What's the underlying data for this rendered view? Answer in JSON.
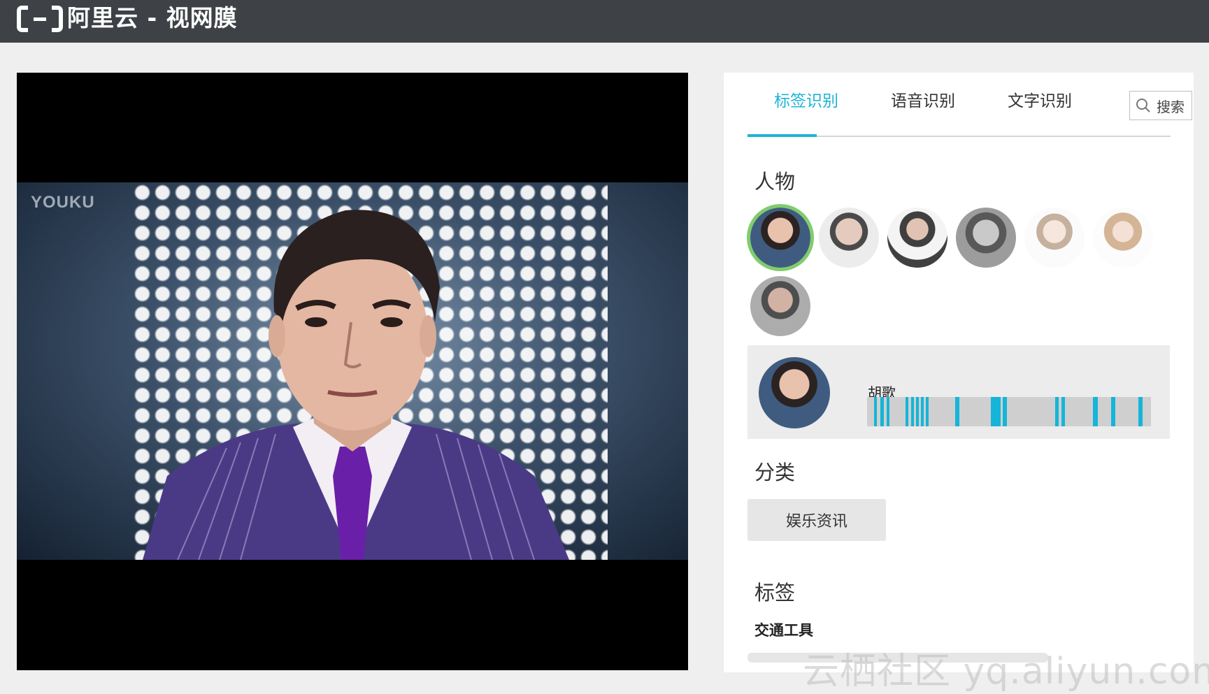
{
  "header": {
    "brand": "阿里云 - 视网膜",
    "logo_icon": "aliyun-logo-icon",
    "background": "#3e4247"
  },
  "video": {
    "watermark": "YOUKU"
  },
  "panel": {
    "tabs": [
      {
        "label": "标签识别",
        "active": true
      },
      {
        "label": "语音识别",
        "active": false
      },
      {
        "label": "文字识别",
        "active": false
      }
    ],
    "search": {
      "placeholder": "搜索",
      "icon": "search-icon"
    },
    "people": {
      "title": "人物",
      "avatar_count": 7,
      "selected_index": 0,
      "selected": {
        "name": "胡歌",
        "timeline_segments": [
          [
            0.025,
            0.035
          ],
          [
            0.047,
            0.058
          ],
          [
            0.07,
            0.08
          ],
          [
            0.135,
            0.145
          ],
          [
            0.155,
            0.165
          ],
          [
            0.172,
            0.182
          ],
          [
            0.19,
            0.2
          ],
          [
            0.207,
            0.216
          ],
          [
            0.31,
            0.325
          ],
          [
            0.435,
            0.47
          ],
          [
            0.478,
            0.492
          ],
          [
            0.662,
            0.675
          ],
          [
            0.685,
            0.698
          ],
          [
            0.795,
            0.812
          ],
          [
            0.86,
            0.875
          ],
          [
            0.955,
            0.97
          ]
        ]
      }
    },
    "category": {
      "title": "分类",
      "tags": [
        "娱乐资讯"
      ]
    },
    "labels": {
      "title": "标签",
      "subheading": "交通工具"
    }
  },
  "site_watermark": "云栖社区 yq.aliyun.com",
  "colors": {
    "accent": "#1eb4d4",
    "selected_ring": "#7fcd6a",
    "timeline_hit": "#14b5d8"
  }
}
